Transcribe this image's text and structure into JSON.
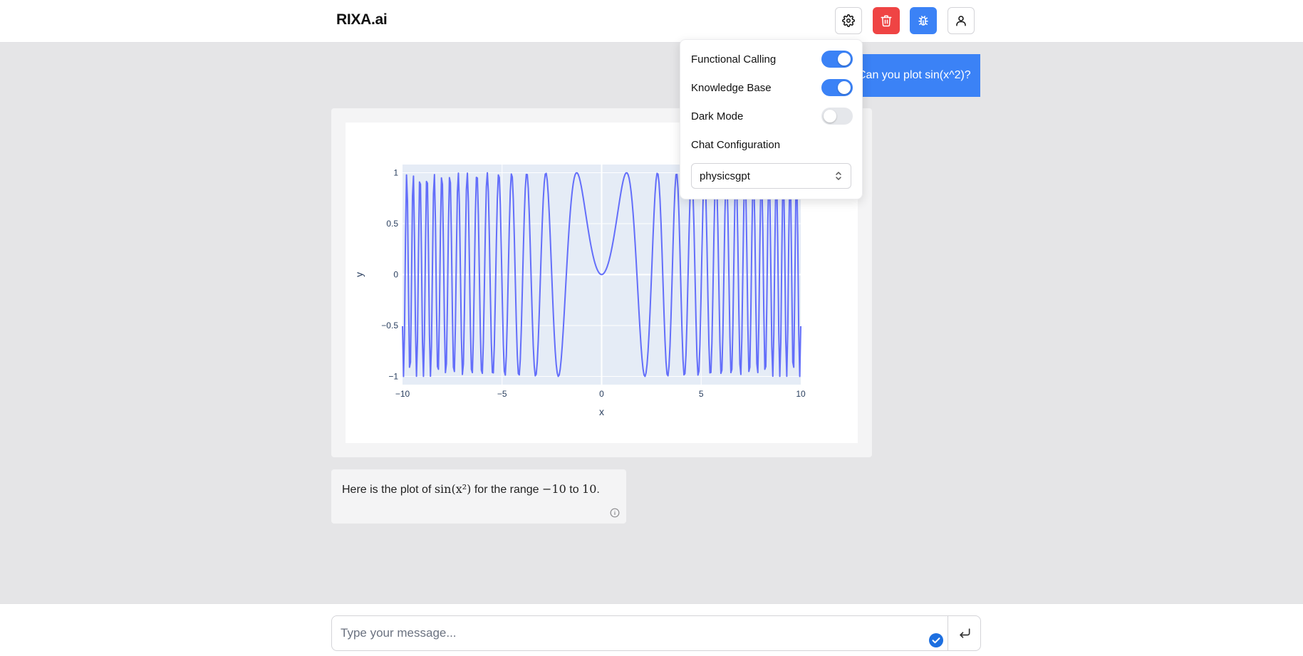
{
  "app": {
    "title": "RIXA.ai"
  },
  "header": {
    "buttons": [
      {
        "name": "settings",
        "icon": "gear-icon"
      },
      {
        "name": "delete",
        "icon": "trash-icon",
        "color": "#ef4444"
      },
      {
        "name": "debug",
        "icon": "bug-icon",
        "color": "#3b82f6"
      },
      {
        "name": "profile",
        "icon": "user-icon"
      }
    ]
  },
  "chat": {
    "user_message": "Can you plot sin(x^2)?",
    "assistant_text": {
      "before": "Here is the plot of ",
      "math1": "sin(x²)",
      "middle": " for the range ",
      "math2": "−10",
      "to": " to ",
      "math3": "10",
      "end": "."
    }
  },
  "settings": {
    "functional_calling": {
      "label": "Functional Calling",
      "enabled": true
    },
    "knowledge_base": {
      "label": "Knowledge Base",
      "enabled": true
    },
    "dark_mode": {
      "label": "Dark Mode",
      "enabled": false
    },
    "chat_configuration": {
      "label": "Chat Configuration",
      "value": "physicsgpt"
    }
  },
  "composer": {
    "placeholder": "Type your message..."
  },
  "colors": {
    "accent": "#3b82f6",
    "danger": "#ef4444",
    "plot_line": "#636efa",
    "plot_bg": "#e5ecf6"
  },
  "chart_data": {
    "type": "line",
    "title": "",
    "xlabel": "x",
    "ylabel": "y",
    "xlim": [
      -10,
      10
    ],
    "ylim": [
      -1.08,
      1.08
    ],
    "x_ticks": [
      -10,
      -5,
      0,
      5,
      10
    ],
    "x_tick_labels": [
      "−10",
      "−5",
      "0",
      "5",
      "10"
    ],
    "y_ticks": [
      1,
      0.5,
      0,
      -0.5,
      -1
    ],
    "y_tick_labels": [
      "1",
      "0.5",
      "0",
      "−0.5",
      "−1"
    ],
    "grid": true,
    "series": [
      {
        "function": "sin(x^2)",
        "x_start": -10,
        "x_end": 10,
        "samples": 400
      }
    ]
  }
}
